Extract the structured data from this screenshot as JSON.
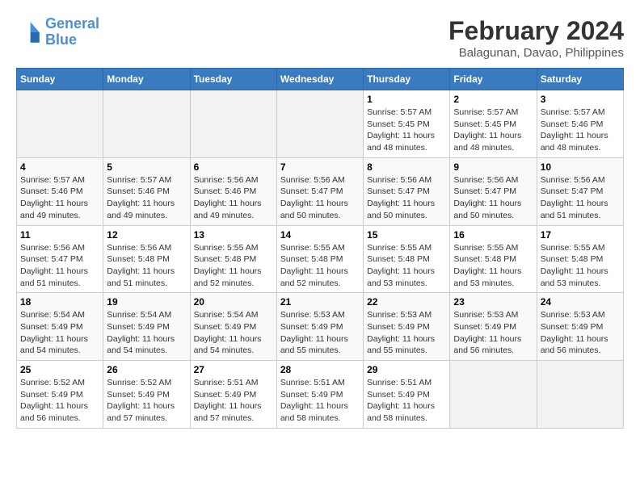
{
  "logo": {
    "line1": "General",
    "line2": "Blue"
  },
  "title": "February 2024",
  "subtitle": "Balagunan, Davao, Philippines",
  "weekdays": [
    "Sunday",
    "Monday",
    "Tuesday",
    "Wednesday",
    "Thursday",
    "Friday",
    "Saturday"
  ],
  "weeks": [
    [
      {
        "day": "",
        "info": ""
      },
      {
        "day": "",
        "info": ""
      },
      {
        "day": "",
        "info": ""
      },
      {
        "day": "",
        "info": ""
      },
      {
        "day": "1",
        "info": "Sunrise: 5:57 AM\nSunset: 5:45 PM\nDaylight: 11 hours\nand 48 minutes."
      },
      {
        "day": "2",
        "info": "Sunrise: 5:57 AM\nSunset: 5:45 PM\nDaylight: 11 hours\nand 48 minutes."
      },
      {
        "day": "3",
        "info": "Sunrise: 5:57 AM\nSunset: 5:46 PM\nDaylight: 11 hours\nand 48 minutes."
      }
    ],
    [
      {
        "day": "4",
        "info": "Sunrise: 5:57 AM\nSunset: 5:46 PM\nDaylight: 11 hours\nand 49 minutes."
      },
      {
        "day": "5",
        "info": "Sunrise: 5:57 AM\nSunset: 5:46 PM\nDaylight: 11 hours\nand 49 minutes."
      },
      {
        "day": "6",
        "info": "Sunrise: 5:56 AM\nSunset: 5:46 PM\nDaylight: 11 hours\nand 49 minutes."
      },
      {
        "day": "7",
        "info": "Sunrise: 5:56 AM\nSunset: 5:47 PM\nDaylight: 11 hours\nand 50 minutes."
      },
      {
        "day": "8",
        "info": "Sunrise: 5:56 AM\nSunset: 5:47 PM\nDaylight: 11 hours\nand 50 minutes."
      },
      {
        "day": "9",
        "info": "Sunrise: 5:56 AM\nSunset: 5:47 PM\nDaylight: 11 hours\nand 50 minutes."
      },
      {
        "day": "10",
        "info": "Sunrise: 5:56 AM\nSunset: 5:47 PM\nDaylight: 11 hours\nand 51 minutes."
      }
    ],
    [
      {
        "day": "11",
        "info": "Sunrise: 5:56 AM\nSunset: 5:47 PM\nDaylight: 11 hours\nand 51 minutes."
      },
      {
        "day": "12",
        "info": "Sunrise: 5:56 AM\nSunset: 5:48 PM\nDaylight: 11 hours\nand 51 minutes."
      },
      {
        "day": "13",
        "info": "Sunrise: 5:55 AM\nSunset: 5:48 PM\nDaylight: 11 hours\nand 52 minutes."
      },
      {
        "day": "14",
        "info": "Sunrise: 5:55 AM\nSunset: 5:48 PM\nDaylight: 11 hours\nand 52 minutes."
      },
      {
        "day": "15",
        "info": "Sunrise: 5:55 AM\nSunset: 5:48 PM\nDaylight: 11 hours\nand 53 minutes."
      },
      {
        "day": "16",
        "info": "Sunrise: 5:55 AM\nSunset: 5:48 PM\nDaylight: 11 hours\nand 53 minutes."
      },
      {
        "day": "17",
        "info": "Sunrise: 5:55 AM\nSunset: 5:48 PM\nDaylight: 11 hours\nand 53 minutes."
      }
    ],
    [
      {
        "day": "18",
        "info": "Sunrise: 5:54 AM\nSunset: 5:49 PM\nDaylight: 11 hours\nand 54 minutes."
      },
      {
        "day": "19",
        "info": "Sunrise: 5:54 AM\nSunset: 5:49 PM\nDaylight: 11 hours\nand 54 minutes."
      },
      {
        "day": "20",
        "info": "Sunrise: 5:54 AM\nSunset: 5:49 PM\nDaylight: 11 hours\nand 54 minutes."
      },
      {
        "day": "21",
        "info": "Sunrise: 5:53 AM\nSunset: 5:49 PM\nDaylight: 11 hours\nand 55 minutes."
      },
      {
        "day": "22",
        "info": "Sunrise: 5:53 AM\nSunset: 5:49 PM\nDaylight: 11 hours\nand 55 minutes."
      },
      {
        "day": "23",
        "info": "Sunrise: 5:53 AM\nSunset: 5:49 PM\nDaylight: 11 hours\nand 56 minutes."
      },
      {
        "day": "24",
        "info": "Sunrise: 5:53 AM\nSunset: 5:49 PM\nDaylight: 11 hours\nand 56 minutes."
      }
    ],
    [
      {
        "day": "25",
        "info": "Sunrise: 5:52 AM\nSunset: 5:49 PM\nDaylight: 11 hours\nand 56 minutes."
      },
      {
        "day": "26",
        "info": "Sunrise: 5:52 AM\nSunset: 5:49 PM\nDaylight: 11 hours\nand 57 minutes."
      },
      {
        "day": "27",
        "info": "Sunrise: 5:51 AM\nSunset: 5:49 PM\nDaylight: 11 hours\nand 57 minutes."
      },
      {
        "day": "28",
        "info": "Sunrise: 5:51 AM\nSunset: 5:49 PM\nDaylight: 11 hours\nand 58 minutes."
      },
      {
        "day": "29",
        "info": "Sunrise: 5:51 AM\nSunset: 5:49 PM\nDaylight: 11 hours\nand 58 minutes."
      },
      {
        "day": "",
        "info": ""
      },
      {
        "day": "",
        "info": ""
      }
    ]
  ]
}
